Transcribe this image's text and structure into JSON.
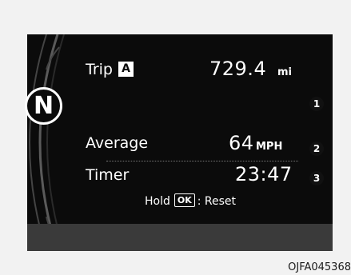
{
  "gear": "N",
  "trip": {
    "label": "Trip",
    "badge": "A",
    "value": "729.4",
    "unit": "mi"
  },
  "average": {
    "label": "Average",
    "value": "64",
    "unit": "MPH"
  },
  "timer": {
    "label": "Timer",
    "value": "23:47"
  },
  "hold": {
    "prefix": "Hold",
    "key": "OK",
    "suffix": ": Reset"
  },
  "callouts": [
    "1",
    "2",
    "3"
  ],
  "figure_code": "OJFA045368",
  "colors": {
    "panel": "#0b0b0b",
    "text": "#ffffff",
    "band": "#3a3a3a"
  }
}
